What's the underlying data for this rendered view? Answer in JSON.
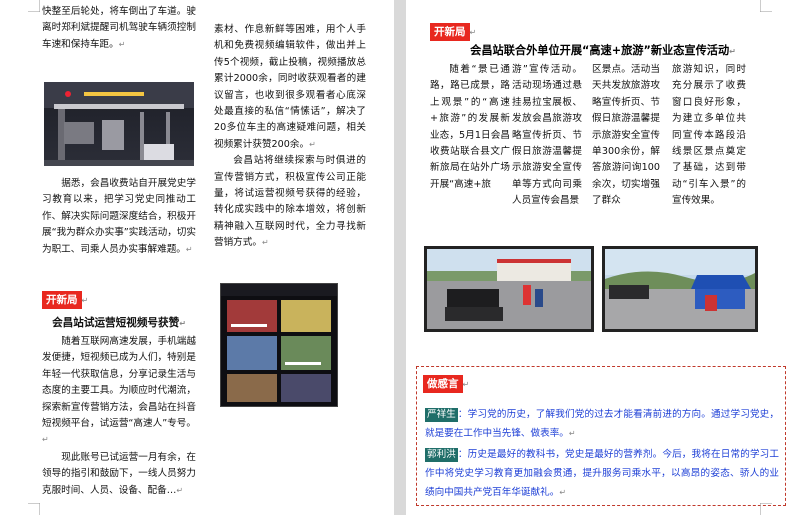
{
  "left_page": {
    "col1": {
      "para_top": "快整至后轮处，将车倒出了车道。驶离时郑利斌提醒司机驾驶车辆须控制车速和保持车距。",
      "para_bottom": "据悉，会昌收费站自开展党史学习教育以来，把学习党史同推动工作、解决实际问题深度结合，积极开展“我为群众办实事”实践活动，切实为职工、司乘人员办实事解难题。",
      "section_tag": "开新局",
      "section_title": "会昌站试运营短视频号获赞",
      "para_video": "随着互联网高速发展，手机端越发便捷，短视频已成为人们，特别是年轻一代获取信息，分享记录生活与态度的主要工具。为顺应时代潮流，探索新宣传营销方法，会昌站在抖音短视频平台，试运营“高速人”专号。",
      "para_last": "现此账号已试运营一月有余，在领导的指引和鼓励下，一线人员努力克服时间、人员、设备、配备…"
    },
    "col2": {
      "para1": "素材、作息新鲜等困难，用个人手机和免费视频编辑软件，做出并上传5个视频，截止投稿，视频播放总累计2000余，同时收获观看者的建议留言，也收到很多观看者心底深处最直接的私信“情愫话”，解决了20多位车主的高速疑难问题，相关视频累计获赞200余。",
      "para2": "会昌站将继续探索与时俱进的宣传营销方式，积极宣传公司正能量，将试运营视频号获得的经验，转化成实践中的除本增效，将创新精神融入互联网时代，全力寻找新营销方式。"
    }
  },
  "right_page": {
    "section_tag": "开新局",
    "headline": "会昌站联合外单位开展“高速+旅游”新业态宣传活动",
    "columns": [
      "随着“景已通路，路已成景，路上观景”的“高速+旅游”的发展新业态，5月1日会昌收费站联合县文广新旅局在站外广场开展“高速+旅",
      "游”宣传活动。活动现场通过悬挂易拉宝展板、发放会昌旅游攻略宣传折页、节假日旅游温馨提示旅游安全宣传单等方式向司乘人员宣传会昌景",
      "区景点。活动当天共发放旅游攻略宣传折页、节假日旅游温馨提示旅游安全宣传单300余份，解答旅游问询100余次，切实增强了群众",
      "旅游知识，同时充分展示了收费窗口良好形象，为建立多单位共同宣传本路段沿线景区景点奠定了基础，达到带动“引车入景”的宣传效果。"
    ],
    "feelings": {
      "tag": "做感言",
      "person1": "严祥生",
      "text1": "学习党的历史，了解我们党的过去才能看清前进的方向。通过学习党史，就是要在工作中当先锋、做表率。",
      "person2": "郭利洪",
      "text2": "历史是最好的教科书，党史是最好的营养剂。今后，我将在日常的学习工作中将党史学习教育更加融会贯通，提升服务司乘水平，以高昂的姿态、骄人的业绩向中国共产党百年华诞献礼。"
    }
  },
  "colors": {
    "tag_red": "#e8281f",
    "name_teal": "#1f6e69",
    "blue_text": "#1d3fd6",
    "frame_red": "#c0392b"
  },
  "paragraph_mark": "↵"
}
